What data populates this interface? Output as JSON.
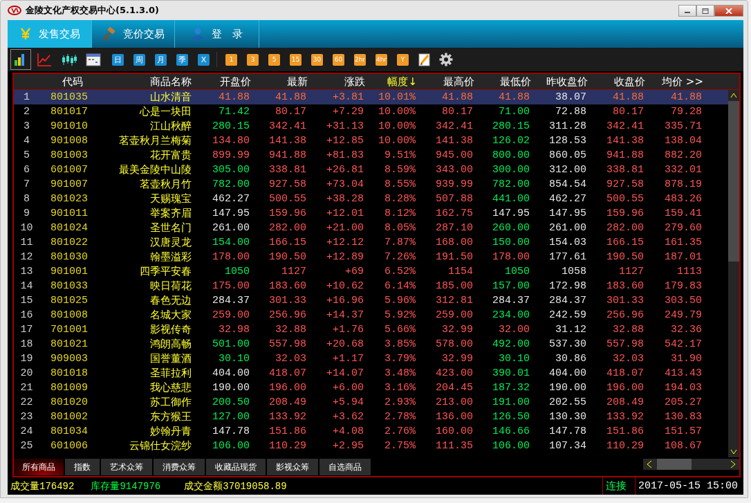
{
  "window": {
    "title": "金陵文化产权交易中心(5.1.3.0)"
  },
  "nav_tabs": [
    {
      "label": "发售交易",
      "selected": true
    },
    {
      "label": "竞价交易",
      "selected": false
    },
    {
      "label": "登　录",
      "selected": false
    }
  ],
  "toolbar": {
    "chart_buttons": [
      {
        "selected": true
      },
      {
        "selected": false
      },
      {
        "selected": false
      },
      {
        "selected": false
      }
    ],
    "period_buttons": [
      {
        "label": "日",
        "kind": "range"
      },
      {
        "label": "周",
        "kind": "range"
      },
      {
        "label": "月",
        "kind": "range"
      },
      {
        "label": "季",
        "kind": "range"
      },
      {
        "label": "X",
        "kind": "range"
      },
      {
        "label": "1",
        "kind": "interval"
      },
      {
        "label": "3",
        "kind": "interval"
      },
      {
        "label": "5",
        "kind": "interval"
      },
      {
        "label": "15",
        "kind": "interval"
      },
      {
        "label": "30",
        "kind": "interval"
      },
      {
        "label": "60",
        "kind": "interval"
      },
      {
        "label": "2hr",
        "kind": "interval"
      },
      {
        "label": "4hr",
        "kind": "interval"
      },
      {
        "label": "Y",
        "kind": "interval"
      }
    ]
  },
  "table": {
    "columns": [
      {
        "label": "代码",
        "sorted": false
      },
      {
        "label": "商品名称",
        "sorted": false
      },
      {
        "label": "开盘价",
        "sorted": false
      },
      {
        "label": "最新",
        "sorted": false
      },
      {
        "label": "涨跌",
        "sorted": false
      },
      {
        "label": "幅度↓",
        "sorted": true
      },
      {
        "label": "最高价",
        "sorted": false
      },
      {
        "label": "最低价",
        "sorted": false
      },
      {
        "label": "昨收盘价",
        "sorted": false
      },
      {
        "label": "收盘价",
        "sorted": false
      },
      {
        "label": "均价 >>",
        "sorted": false
      }
    ],
    "rows": [
      {
        "no": "1",
        "code": "801035",
        "name": "山水清音",
        "selected": true,
        "values": [
          {
            "text": "41.88",
            "color": "#ff6a30"
          },
          {
            "text": "41.88",
            "color": "#ff6a30"
          },
          {
            "text": "+3.81",
            "color": "#ff6a30"
          },
          {
            "text": "10.01%",
            "color": "#ff6a30"
          },
          {
            "text": "41.88",
            "color": "#ff6a30"
          },
          {
            "text": "41.88",
            "color": "#ff6a30"
          },
          {
            "text": "38.07",
            "color": "#e8e8e8"
          },
          {
            "text": "41.88",
            "color": "#ff6a30"
          },
          {
            "text": "41.88",
            "color": "#ff6a30"
          }
        ]
      },
      {
        "no": "2",
        "code": "801017",
        "name": "心是一块田",
        "selected": false,
        "values": [
          {
            "text": "71.42",
            "color": "#00ee55"
          },
          {
            "text": "80.17",
            "color": "#ff5555"
          },
          {
            "text": "+7.29",
            "color": "#ff5555"
          },
          {
            "text": "10.00%",
            "color": "#ff5555"
          },
          {
            "text": "80.17",
            "color": "#ff5555"
          },
          {
            "text": "71.00",
            "color": "#00ee55"
          },
          {
            "text": "72.88",
            "color": "#e8e8e8"
          },
          {
            "text": "80.17",
            "color": "#ff5555"
          },
          {
            "text": "79.28",
            "color": "#ff5555"
          }
        ]
      },
      {
        "no": "3",
        "code": "901010",
        "name": "江山秋醉",
        "selected": false,
        "values": [
          {
            "text": "280.15",
            "color": "#00ee55"
          },
          {
            "text": "342.41",
            "color": "#ff5555"
          },
          {
            "text": "+31.13",
            "color": "#ff5555"
          },
          {
            "text": "10.00%",
            "color": "#ff5555"
          },
          {
            "text": "342.41",
            "color": "#ff5555"
          },
          {
            "text": "280.15",
            "color": "#00ee55"
          },
          {
            "text": "311.28",
            "color": "#e8e8e8"
          },
          {
            "text": "342.41",
            "color": "#ff5555"
          },
          {
            "text": "335.71",
            "color": "#ff5555"
          }
        ]
      },
      {
        "no": "4",
        "code": "901008",
        "name": "茗壶秋月兰梅菊",
        "selected": false,
        "values": [
          {
            "text": "134.80",
            "color": "#ff5555"
          },
          {
            "text": "141.38",
            "color": "#ff5555"
          },
          {
            "text": "+12.85",
            "color": "#ff5555"
          },
          {
            "text": "10.00%",
            "color": "#ff5555"
          },
          {
            "text": "141.38",
            "color": "#ff5555"
          },
          {
            "text": "126.02",
            "color": "#00ee55"
          },
          {
            "text": "128.53",
            "color": "#e8e8e8"
          },
          {
            "text": "141.38",
            "color": "#ff5555"
          },
          {
            "text": "138.04",
            "color": "#ff5555"
          }
        ]
      },
      {
        "no": "5",
        "code": "801003",
        "name": "花开富贵",
        "selected": false,
        "values": [
          {
            "text": "899.99",
            "color": "#ff5555"
          },
          {
            "text": "941.88",
            "color": "#ff5555"
          },
          {
            "text": "+81.83",
            "color": "#ff5555"
          },
          {
            "text": "9.51%",
            "color": "#ff5555"
          },
          {
            "text": "945.00",
            "color": "#ff5555"
          },
          {
            "text": "800.00",
            "color": "#00ee55"
          },
          {
            "text": "860.05",
            "color": "#e8e8e8"
          },
          {
            "text": "941.88",
            "color": "#ff5555"
          },
          {
            "text": "882.20",
            "color": "#ff5555"
          }
        ]
      },
      {
        "no": "6",
        "code": "601007",
        "name": "最美金陵中山陵",
        "selected": false,
        "values": [
          {
            "text": "305.00",
            "color": "#00ee55"
          },
          {
            "text": "338.81",
            "color": "#ff5555"
          },
          {
            "text": "+26.81",
            "color": "#ff5555"
          },
          {
            "text": "8.59%",
            "color": "#ff5555"
          },
          {
            "text": "343.00",
            "color": "#ff5555"
          },
          {
            "text": "300.00",
            "color": "#00ee55"
          },
          {
            "text": "312.00",
            "color": "#e8e8e8"
          },
          {
            "text": "338.81",
            "color": "#ff5555"
          },
          {
            "text": "332.01",
            "color": "#ff5555"
          }
        ]
      },
      {
        "no": "7",
        "code": "901007",
        "name": "茗壶秋月竹",
        "selected": false,
        "values": [
          {
            "text": "782.00",
            "color": "#00ee55"
          },
          {
            "text": "927.58",
            "color": "#ff5555"
          },
          {
            "text": "+73.04",
            "color": "#ff5555"
          },
          {
            "text": "8.55%",
            "color": "#ff5555"
          },
          {
            "text": "939.99",
            "color": "#ff5555"
          },
          {
            "text": "782.00",
            "color": "#00ee55"
          },
          {
            "text": "854.54",
            "color": "#e8e8e8"
          },
          {
            "text": "927.58",
            "color": "#ff5555"
          },
          {
            "text": "878.19",
            "color": "#ff5555"
          }
        ]
      },
      {
        "no": "8",
        "code": "801023",
        "name": "天赐瑰宝",
        "selected": false,
        "values": [
          {
            "text": "462.27",
            "color": "#e8e8e8"
          },
          {
            "text": "500.55",
            "color": "#ff5555"
          },
          {
            "text": "+38.28",
            "color": "#ff5555"
          },
          {
            "text": "8.28%",
            "color": "#ff5555"
          },
          {
            "text": "507.88",
            "color": "#ff5555"
          },
          {
            "text": "441.00",
            "color": "#00ee55"
          },
          {
            "text": "462.27",
            "color": "#e8e8e8"
          },
          {
            "text": "500.55",
            "color": "#ff5555"
          },
          {
            "text": "483.26",
            "color": "#ff5555"
          }
        ]
      },
      {
        "no": "9",
        "code": "901011",
        "name": "举案齐眉",
        "selected": false,
        "values": [
          {
            "text": "147.95",
            "color": "#e8e8e8"
          },
          {
            "text": "159.96",
            "color": "#ff5555"
          },
          {
            "text": "+12.01",
            "color": "#ff5555"
          },
          {
            "text": "8.12%",
            "color": "#ff5555"
          },
          {
            "text": "162.75",
            "color": "#ff5555"
          },
          {
            "text": "147.95",
            "color": "#e8e8e8"
          },
          {
            "text": "147.95",
            "color": "#e8e8e8"
          },
          {
            "text": "159.96",
            "color": "#ff5555"
          },
          {
            "text": "159.41",
            "color": "#ff5555"
          }
        ]
      },
      {
        "no": "10",
        "code": "801024",
        "name": "圣世名门",
        "selected": false,
        "values": [
          {
            "text": "261.00",
            "color": "#e8e8e8"
          },
          {
            "text": "282.00",
            "color": "#ff5555"
          },
          {
            "text": "+21.00",
            "color": "#ff5555"
          },
          {
            "text": "8.05%",
            "color": "#ff5555"
          },
          {
            "text": "287.10",
            "color": "#ff5555"
          },
          {
            "text": "260.00",
            "color": "#00ee55"
          },
          {
            "text": "261.00",
            "color": "#e8e8e8"
          },
          {
            "text": "282.00",
            "color": "#ff5555"
          },
          {
            "text": "279.60",
            "color": "#ff5555"
          }
        ]
      },
      {
        "no": "11",
        "code": "801022",
        "name": "汉唐灵龙",
        "selected": false,
        "values": [
          {
            "text": "154.00",
            "color": "#00ee55"
          },
          {
            "text": "166.15",
            "color": "#ff5555"
          },
          {
            "text": "+12.12",
            "color": "#ff5555"
          },
          {
            "text": "7.87%",
            "color": "#ff5555"
          },
          {
            "text": "168.00",
            "color": "#ff5555"
          },
          {
            "text": "150.00",
            "color": "#00ee55"
          },
          {
            "text": "154.03",
            "color": "#e8e8e8"
          },
          {
            "text": "166.15",
            "color": "#ff5555"
          },
          {
            "text": "161.35",
            "color": "#ff5555"
          }
        ]
      },
      {
        "no": "12",
        "code": "801030",
        "name": "翰墨溢彩",
        "selected": false,
        "values": [
          {
            "text": "178.00",
            "color": "#ff5555"
          },
          {
            "text": "190.50",
            "color": "#ff5555"
          },
          {
            "text": "+12.89",
            "color": "#ff5555"
          },
          {
            "text": "7.26%",
            "color": "#ff5555"
          },
          {
            "text": "191.50",
            "color": "#ff5555"
          },
          {
            "text": "178.00",
            "color": "#ff5555"
          },
          {
            "text": "177.61",
            "color": "#e8e8e8"
          },
          {
            "text": "190.50",
            "color": "#ff5555"
          },
          {
            "text": "187.01",
            "color": "#ff5555"
          }
        ]
      },
      {
        "no": "13",
        "code": "901001",
        "name": "四季平安春",
        "selected": false,
        "values": [
          {
            "text": "1050",
            "color": "#00ee55"
          },
          {
            "text": "1127",
            "color": "#ff5555"
          },
          {
            "text": "+69",
            "color": "#ff5555"
          },
          {
            "text": "6.52%",
            "color": "#ff5555"
          },
          {
            "text": "1154",
            "color": "#ff5555"
          },
          {
            "text": "1050",
            "color": "#00ee55"
          },
          {
            "text": "1058",
            "color": "#e8e8e8"
          },
          {
            "text": "1127",
            "color": "#ff5555"
          },
          {
            "text": "1113",
            "color": "#ff5555"
          }
        ]
      },
      {
        "no": "14",
        "code": "801033",
        "name": "映日荷花",
        "selected": false,
        "values": [
          {
            "text": "175.00",
            "color": "#ff5555"
          },
          {
            "text": "183.60",
            "color": "#ff5555"
          },
          {
            "text": "+10.62",
            "color": "#ff5555"
          },
          {
            "text": "6.14%",
            "color": "#ff5555"
          },
          {
            "text": "185.00",
            "color": "#ff5555"
          },
          {
            "text": "157.00",
            "color": "#00ee55"
          },
          {
            "text": "172.98",
            "color": "#e8e8e8"
          },
          {
            "text": "183.60",
            "color": "#ff5555"
          },
          {
            "text": "179.83",
            "color": "#ff5555"
          }
        ]
      },
      {
        "no": "15",
        "code": "801025",
        "name": "春色无边",
        "selected": false,
        "values": [
          {
            "text": "284.37",
            "color": "#e8e8e8"
          },
          {
            "text": "301.33",
            "color": "#ff5555"
          },
          {
            "text": "+16.96",
            "color": "#ff5555"
          },
          {
            "text": "5.96%",
            "color": "#ff5555"
          },
          {
            "text": "312.81",
            "color": "#ff5555"
          },
          {
            "text": "284.37",
            "color": "#e8e8e8"
          },
          {
            "text": "284.37",
            "color": "#e8e8e8"
          },
          {
            "text": "301.33",
            "color": "#ff5555"
          },
          {
            "text": "303.50",
            "color": "#ff5555"
          }
        ]
      },
      {
        "no": "16",
        "code": "801008",
        "name": "名城大家",
        "selected": false,
        "values": [
          {
            "text": "259.00",
            "color": "#ff5555"
          },
          {
            "text": "256.96",
            "color": "#ff5555"
          },
          {
            "text": "+14.37",
            "color": "#ff5555"
          },
          {
            "text": "5.92%",
            "color": "#ff5555"
          },
          {
            "text": "259.00",
            "color": "#ff5555"
          },
          {
            "text": "234.00",
            "color": "#00ee55"
          },
          {
            "text": "242.59",
            "color": "#e8e8e8"
          },
          {
            "text": "256.96",
            "color": "#ff5555"
          },
          {
            "text": "249.79",
            "color": "#ff5555"
          }
        ]
      },
      {
        "no": "17",
        "code": "701001",
        "name": "影视传奇",
        "selected": false,
        "values": [
          {
            "text": "32.98",
            "color": "#ff5555"
          },
          {
            "text": "32.88",
            "color": "#ff5555"
          },
          {
            "text": "+1.76",
            "color": "#ff5555"
          },
          {
            "text": "5.66%",
            "color": "#ff5555"
          },
          {
            "text": "32.99",
            "color": "#ff5555"
          },
          {
            "text": "32.00",
            "color": "#ff5555"
          },
          {
            "text": "31.12",
            "color": "#e8e8e8"
          },
          {
            "text": "32.88",
            "color": "#ff5555"
          },
          {
            "text": "32.36",
            "color": "#ff5555"
          }
        ]
      },
      {
        "no": "18",
        "code": "801021",
        "name": "鸿朗高畅",
        "selected": false,
        "values": [
          {
            "text": "501.00",
            "color": "#00ee55"
          },
          {
            "text": "557.98",
            "color": "#ff5555"
          },
          {
            "text": "+20.68",
            "color": "#ff5555"
          },
          {
            "text": "3.85%",
            "color": "#ff5555"
          },
          {
            "text": "578.00",
            "color": "#ff5555"
          },
          {
            "text": "492.00",
            "color": "#00ee55"
          },
          {
            "text": "537.30",
            "color": "#e8e8e8"
          },
          {
            "text": "557.98",
            "color": "#ff5555"
          },
          {
            "text": "542.17",
            "color": "#ff5555"
          }
        ]
      },
      {
        "no": "19",
        "code": "909003",
        "name": "国誉董酒",
        "selected": false,
        "values": [
          {
            "text": "30.10",
            "color": "#00ee55"
          },
          {
            "text": "32.03",
            "color": "#ff5555"
          },
          {
            "text": "+1.17",
            "color": "#ff5555"
          },
          {
            "text": "3.79%",
            "color": "#ff5555"
          },
          {
            "text": "32.99",
            "color": "#ff5555"
          },
          {
            "text": "30.10",
            "color": "#00ee55"
          },
          {
            "text": "30.86",
            "color": "#e8e8e8"
          },
          {
            "text": "32.03",
            "color": "#ff5555"
          },
          {
            "text": "31.90",
            "color": "#ff5555"
          }
        ]
      },
      {
        "no": "20",
        "code": "801018",
        "name": "圣菲拉利",
        "selected": false,
        "values": [
          {
            "text": "404.00",
            "color": "#e8e8e8"
          },
          {
            "text": "418.07",
            "color": "#ff5555"
          },
          {
            "text": "+14.07",
            "color": "#ff5555"
          },
          {
            "text": "3.48%",
            "color": "#ff5555"
          },
          {
            "text": "423.00",
            "color": "#ff5555"
          },
          {
            "text": "390.01",
            "color": "#00ee55"
          },
          {
            "text": "404.00",
            "color": "#e8e8e8"
          },
          {
            "text": "418.07",
            "color": "#ff5555"
          },
          {
            "text": "413.43",
            "color": "#ff5555"
          }
        ]
      },
      {
        "no": "21",
        "code": "801009",
        "name": "我心慈悲",
        "selected": false,
        "values": [
          {
            "text": "190.00",
            "color": "#e8e8e8"
          },
          {
            "text": "196.00",
            "color": "#ff5555"
          },
          {
            "text": "+6.00",
            "color": "#ff5555"
          },
          {
            "text": "3.16%",
            "color": "#ff5555"
          },
          {
            "text": "204.45",
            "color": "#ff5555"
          },
          {
            "text": "187.32",
            "color": "#00ee55"
          },
          {
            "text": "190.00",
            "color": "#e8e8e8"
          },
          {
            "text": "196.00",
            "color": "#ff5555"
          },
          {
            "text": "194.03",
            "color": "#ff5555"
          }
        ]
      },
      {
        "no": "22",
        "code": "801020",
        "name": "苏工御作",
        "selected": false,
        "values": [
          {
            "text": "200.50",
            "color": "#00ee55"
          },
          {
            "text": "208.49",
            "color": "#ff5555"
          },
          {
            "text": "+5.94",
            "color": "#ff5555"
          },
          {
            "text": "2.93%",
            "color": "#ff5555"
          },
          {
            "text": "213.00",
            "color": "#ff5555"
          },
          {
            "text": "191.00",
            "color": "#00ee55"
          },
          {
            "text": "202.55",
            "color": "#e8e8e8"
          },
          {
            "text": "208.49",
            "color": "#ff5555"
          },
          {
            "text": "205.27",
            "color": "#ff5555"
          }
        ]
      },
      {
        "no": "23",
        "code": "801002",
        "name": "东方猴王",
        "selected": false,
        "values": [
          {
            "text": "127.00",
            "color": "#00ee55"
          },
          {
            "text": "133.92",
            "color": "#ff5555"
          },
          {
            "text": "+3.62",
            "color": "#ff5555"
          },
          {
            "text": "2.78%",
            "color": "#ff5555"
          },
          {
            "text": "136.00",
            "color": "#ff5555"
          },
          {
            "text": "126.50",
            "color": "#00ee55"
          },
          {
            "text": "130.30",
            "color": "#e8e8e8"
          },
          {
            "text": "133.92",
            "color": "#ff5555"
          },
          {
            "text": "130.83",
            "color": "#ff5555"
          }
        ]
      },
      {
        "no": "24",
        "code": "801034",
        "name": "妙翰丹青",
        "selected": false,
        "values": [
          {
            "text": "147.78",
            "color": "#e8e8e8"
          },
          {
            "text": "151.86",
            "color": "#ff5555"
          },
          {
            "text": "+4.08",
            "color": "#ff5555"
          },
          {
            "text": "2.76%",
            "color": "#ff5555"
          },
          {
            "text": "160.00",
            "color": "#ff5555"
          },
          {
            "text": "146.66",
            "color": "#00ee55"
          },
          {
            "text": "147.78",
            "color": "#e8e8e8"
          },
          {
            "text": "151.86",
            "color": "#ff5555"
          },
          {
            "text": "151.57",
            "color": "#ff5555"
          }
        ]
      },
      {
        "no": "25",
        "code": "601006",
        "name": "云锦仕女浣纱",
        "selected": false,
        "values": [
          {
            "text": "106.00",
            "color": "#00ee55"
          },
          {
            "text": "110.29",
            "color": "#ff5555"
          },
          {
            "text": "+2.95",
            "color": "#ff5555"
          },
          {
            "text": "2.75%",
            "color": "#ff5555"
          },
          {
            "text": "111.35",
            "color": "#ff5555"
          },
          {
            "text": "106.00",
            "color": "#00ee55"
          },
          {
            "text": "107.34",
            "color": "#e8e8e8"
          },
          {
            "text": "110.29",
            "color": "#ff5555"
          },
          {
            "text": "108.67",
            "color": "#ff5555"
          }
        ]
      }
    ]
  },
  "category_tabs": [
    {
      "label": "所有商品",
      "selected": true
    },
    {
      "label": "指数",
      "selected": false
    },
    {
      "label": "艺术众筹",
      "selected": false
    },
    {
      "label": "消费众筹",
      "selected": false
    },
    {
      "label": "收藏品现货",
      "selected": false
    },
    {
      "label": "影视众筹",
      "selected": false
    },
    {
      "label": "自选商品",
      "selected": false
    }
  ],
  "status_bar": {
    "stats": [
      {
        "text": "成交量176492",
        "color": "#ffff40"
      },
      {
        "text": "库存量9147976",
        "color": "#00ff40"
      },
      {
        "text": "成交金额37019058.89",
        "color": "#ffff40"
      }
    ],
    "connection": "连接",
    "datetime": "2017-05-15 15:00"
  }
}
